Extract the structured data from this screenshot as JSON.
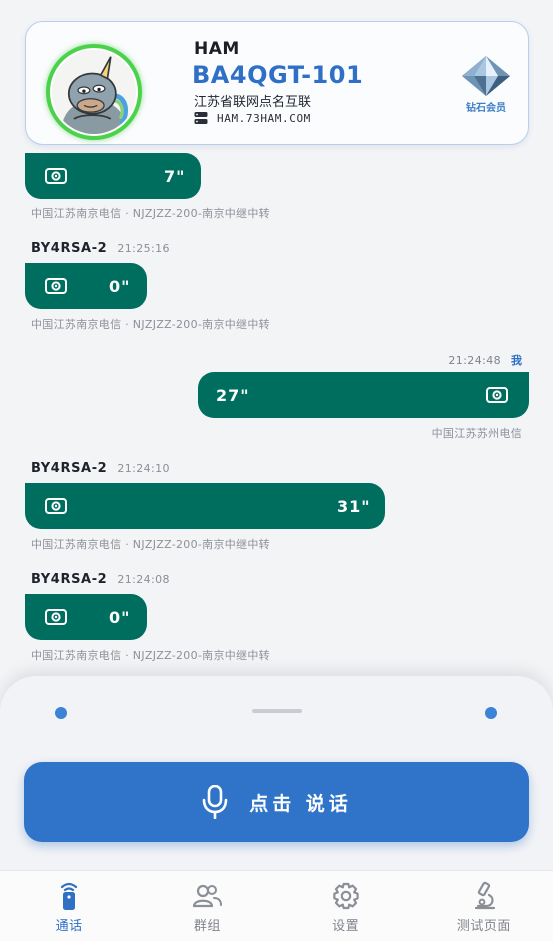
{
  "profile": {
    "title": "HAM",
    "callsign": "BA4QGT-101",
    "location": "江苏省联网点名互联",
    "server": "HAM.73HAM.COM",
    "badge_label": "钻石会员"
  },
  "messages": [
    {
      "sender": "",
      "time": "",
      "duration": "7\"",
      "meta": "中国江苏南京电信 · NJZJZZ-200-南京中继中转",
      "self": false
    },
    {
      "sender": "BY4RSA-2",
      "time": "21:25:16",
      "duration": "0\"",
      "meta": "中国江苏南京电信 · NJZJZZ-200-南京中继中转",
      "self": false
    },
    {
      "sender": "我",
      "time": "21:24:48",
      "duration": "27\"",
      "meta": "中国江苏苏州电信",
      "self": true
    },
    {
      "sender": "BY4RSA-2",
      "time": "21:24:10",
      "duration": "31\"",
      "meta": "中国江苏南京电信 · NJZJZZ-200-南京中继中转",
      "self": false
    },
    {
      "sender": "BY4RSA-2",
      "time": "21:24:08",
      "duration": "0\"",
      "meta": "中国江苏南京电信 · NJZJZZ-200-南京中继中转",
      "self": false
    }
  ],
  "talk": {
    "label": "点击 说话"
  },
  "tabs": [
    {
      "label": "通话",
      "icon": "radio-icon",
      "active": true
    },
    {
      "label": "群组",
      "icon": "group-icon",
      "active": false
    },
    {
      "label": "设置",
      "icon": "gear-icon",
      "active": false
    },
    {
      "label": "测试页面",
      "icon": "microscope-icon",
      "active": false
    }
  ],
  "colors": {
    "accent": "#2f74c9",
    "bubble": "#006e5f",
    "status_ring": "#4bd14b"
  }
}
